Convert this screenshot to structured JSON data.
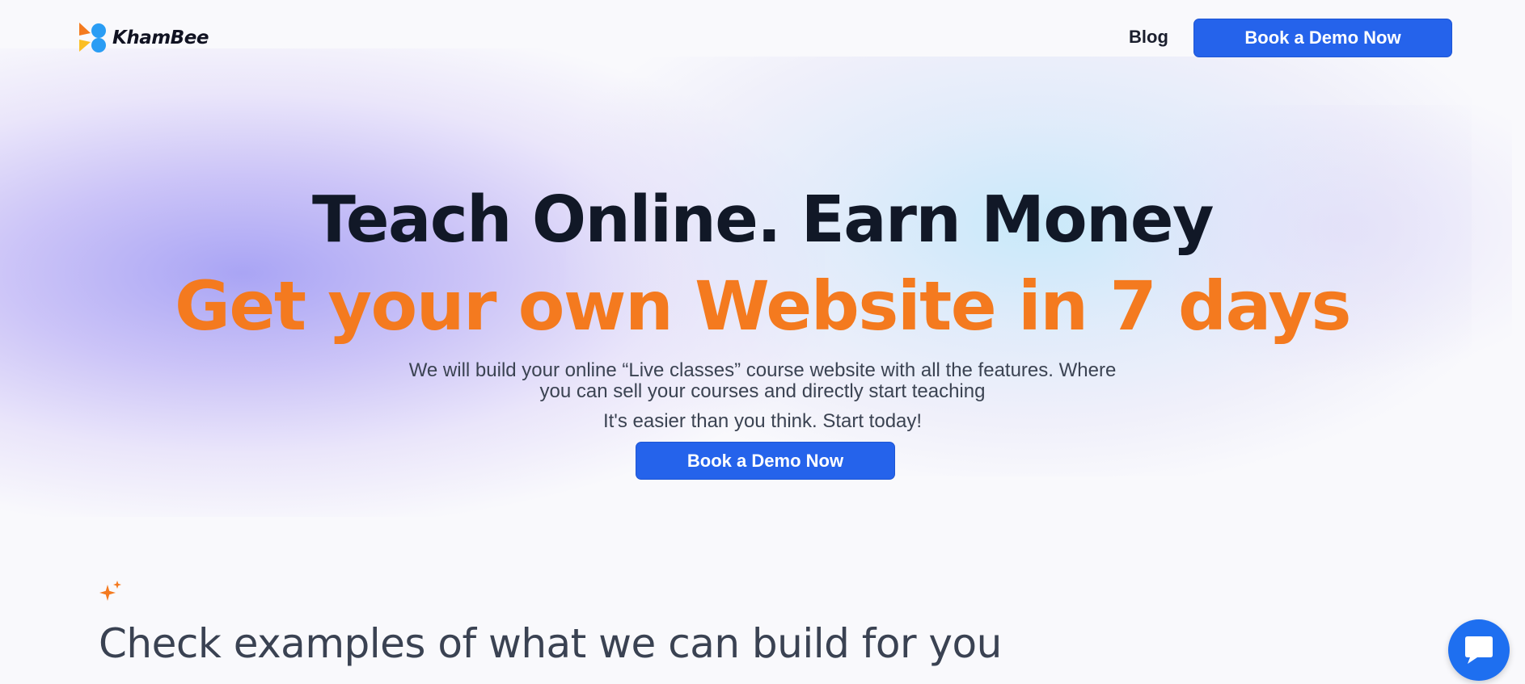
{
  "header": {
    "logo_text": "KhamBee",
    "nav_blog_label": "Blog",
    "cta_label": "Book a Demo Now"
  },
  "hero": {
    "headline": "Teach Online. Earn Money",
    "subheadline": "Get your own Website in 7 days",
    "description": "We will build your online “Live classes” course website with all the features. Where you can sell your courses and directly start teaching",
    "tagline": "It's easier than you think. Start today!",
    "cta_label": "Book a Demo Now"
  },
  "examples": {
    "title": "Check examples of what we can build for you"
  },
  "colors": {
    "primary_button": "#2563eb",
    "accent_orange": "#f47a1f",
    "headline_dark": "#111827",
    "body_text": "#3b4352",
    "chat_button": "#1e6ff0"
  },
  "icons": {
    "logo": "khambee-logo-icon",
    "sparkle": "sparkle-icon",
    "chat": "chat-bubble-icon"
  }
}
